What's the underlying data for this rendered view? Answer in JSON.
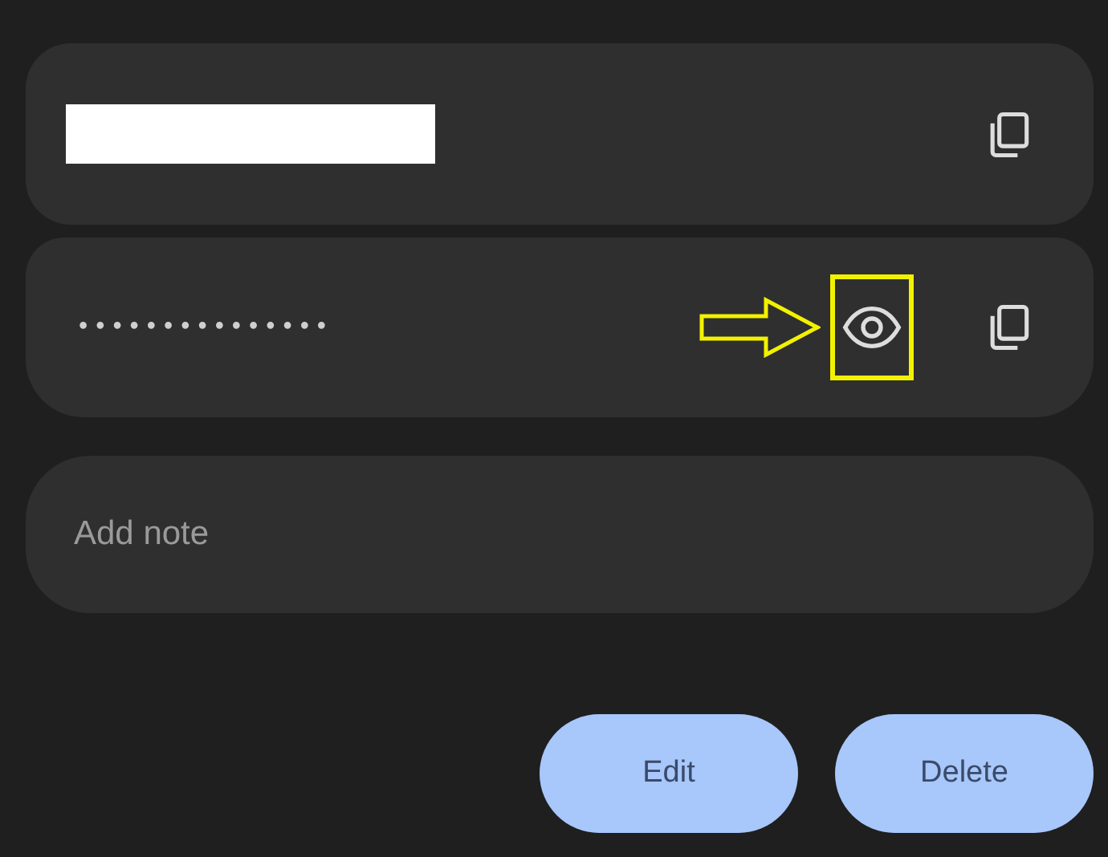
{
  "username": {
    "redacted": true
  },
  "password": {
    "masked": "•••••••••••••••"
  },
  "note": {
    "placeholder": "Add note"
  },
  "buttons": [
    {
      "label": "Edit"
    },
    {
      "label": "Delete"
    }
  ]
}
